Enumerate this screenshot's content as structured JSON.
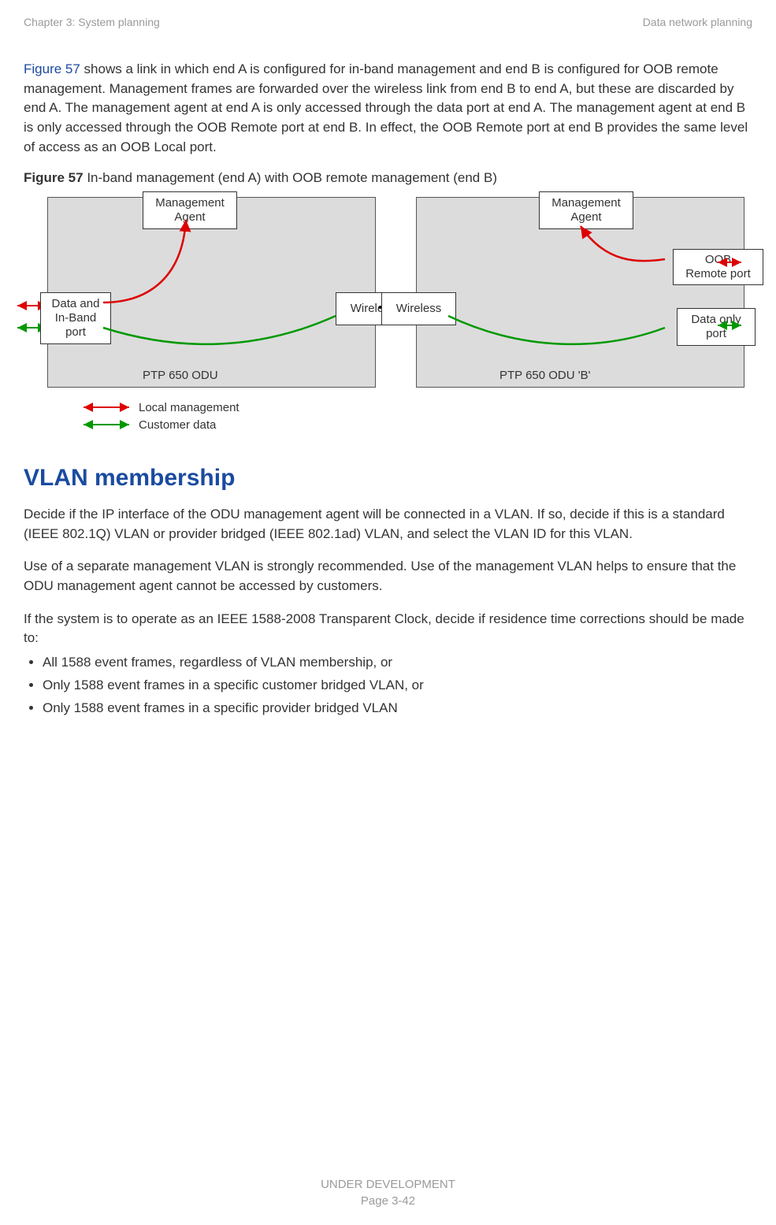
{
  "header": {
    "left": "Chapter 3:  System planning",
    "right": "Data network planning"
  },
  "para1": {
    "ref": "Figure 57",
    "rest": " shows a link in which end A is configured for in-band management and end B is configured for OOB remote management. Management frames are forwarded over the wireless link from end B to end A, but these are discarded by end A. The management agent at end A is only accessed through the data port at end A. The management agent at end B is only accessed through the OOB Remote port at end B. In effect, the OOB Remote port at end B provides the same level of access as an OOB Local port."
  },
  "figure": {
    "label": "Figure 57",
    "caption": "  In-band management (end A) with OOB remote management (end B)",
    "boxes": {
      "mgmtA": "Management\nAgent",
      "dataA": "Data and\nIn-Band\nport",
      "wirelessA": "Wireless",
      "wirelessB": "Wireless",
      "mgmtB": "Management\nAgent",
      "oobB": "OOB\nRemote port",
      "dataB": "Data only\nport"
    },
    "oduA": "PTP 650 ODU",
    "oduB": "PTP 650 ODU 'B'",
    "legend": {
      "local": "Local management",
      "cust": "Customer data"
    }
  },
  "section": {
    "title": "VLAN membership",
    "p1": "Decide if the IP interface of the ODU management agent will be connected in a VLAN. If so, decide if this is a standard (IEEE 802.1Q) VLAN or provider bridged (IEEE 802.1ad) VLAN, and select the VLAN ID for this VLAN.",
    "p2": "Use of a separate management VLAN is strongly recommended. Use of the management VLAN helps to ensure that the ODU management agent cannot be accessed by customers.",
    "p3": "If the system is to operate as an IEEE 1588-2008 Transparent Clock, decide if residence time corrections should be made to:",
    "b1": "All 1588 event frames, regardless of VLAN membership, or",
    "b2": "Only 1588 event frames in a specific customer bridged VLAN, or",
    "b3": "Only 1588 event frames in a specific provider bridged VLAN"
  },
  "footer": {
    "line1": "UNDER DEVELOPMENT",
    "line2": "Page 3-42"
  }
}
